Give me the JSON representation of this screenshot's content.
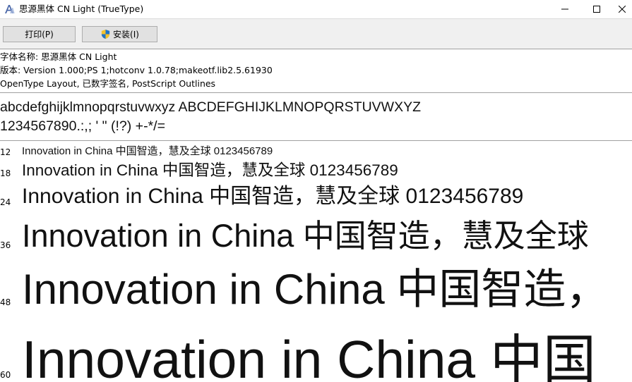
{
  "window": {
    "title": "思源黑体 CN Light (TrueType)",
    "icon": "font-a-icon",
    "controls": [
      "minimize-icon",
      "maximize-icon",
      "close-icon"
    ]
  },
  "toolbar": {
    "print_label": "打印(P)",
    "install_label": "安装(I)",
    "install_icon": "uac-shield-icon"
  },
  "info": {
    "font_name": "字体名称: 思源黑体 CN Light",
    "version": "版本: Version 1.000;PS 1;hotconv 1.0.78;makeotf.lib2.5.61930",
    "type": "OpenType Layout, 已数字签名, PostScript Outlines"
  },
  "charset": {
    "letters": "abcdefghijklmnopqrstuvwxyz ABCDEFGHIJKLMNOPQRSTUVWXYZ",
    "digits": "1234567890.:,; ' \" (!?) +-*/="
  },
  "samples": [
    {
      "size": "12",
      "text": "Innovation in China 中国智造，慧及全球 0123456789"
    },
    {
      "size": "18",
      "text": "Innovation in China 中国智造，慧及全球 0123456789"
    },
    {
      "size": "24",
      "text": "Innovation in China 中国智造，慧及全球 0123456789"
    },
    {
      "size": "36",
      "text": "Innovation in China 中国智造，慧及全球"
    },
    {
      "size": "48",
      "text": "Innovation in China 中国智造，"
    },
    {
      "size": "60",
      "text": "Innovation in China 中国"
    }
  ],
  "colors": {
    "toolbar_bg": "#f0f0f0",
    "button_bg": "#e1e1e1",
    "shield_blue": "#1e73c8",
    "shield_yellow": "#f2c12e"
  }
}
